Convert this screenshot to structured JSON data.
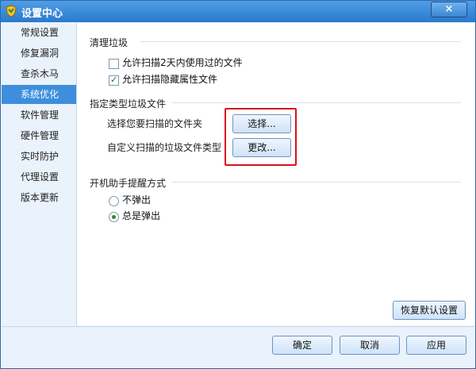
{
  "window": {
    "title": "设置中心",
    "close_label": "×"
  },
  "sidebar": {
    "items": [
      {
        "label": "常规设置"
      },
      {
        "label": "修复漏洞"
      },
      {
        "label": "查杀木马"
      },
      {
        "label": "系统优化"
      },
      {
        "label": "软件管理"
      },
      {
        "label": "硬件管理"
      },
      {
        "label": "实时防护"
      },
      {
        "label": "代理设置"
      },
      {
        "label": "版本更新"
      }
    ],
    "active_index": 3
  },
  "sections": {
    "clean": {
      "title": "清理垃圾",
      "options": [
        {
          "label": "允许扫描2天内使用过的文件",
          "checked": false
        },
        {
          "label": "允许扫描隐藏属性文件",
          "checked": true
        }
      ]
    },
    "types": {
      "title": "指定类型垃圾文件",
      "rows": [
        {
          "label": "选择您要扫描的文件夹",
          "button": "选择..."
        },
        {
          "label": "自定义扫描的垃圾文件类型",
          "button": "更改..."
        }
      ]
    },
    "reminder": {
      "title": "开机助手提醒方式",
      "options": [
        {
          "label": "不弹出",
          "selected": false
        },
        {
          "label": "总是弹出",
          "selected": true
        }
      ]
    }
  },
  "buttons": {
    "restore": "恢复默认设置",
    "ok": "确定",
    "cancel": "取消",
    "apply": "应用"
  },
  "colors": {
    "accent": "#3d8fdd",
    "highlight_box": "#d6131e"
  }
}
